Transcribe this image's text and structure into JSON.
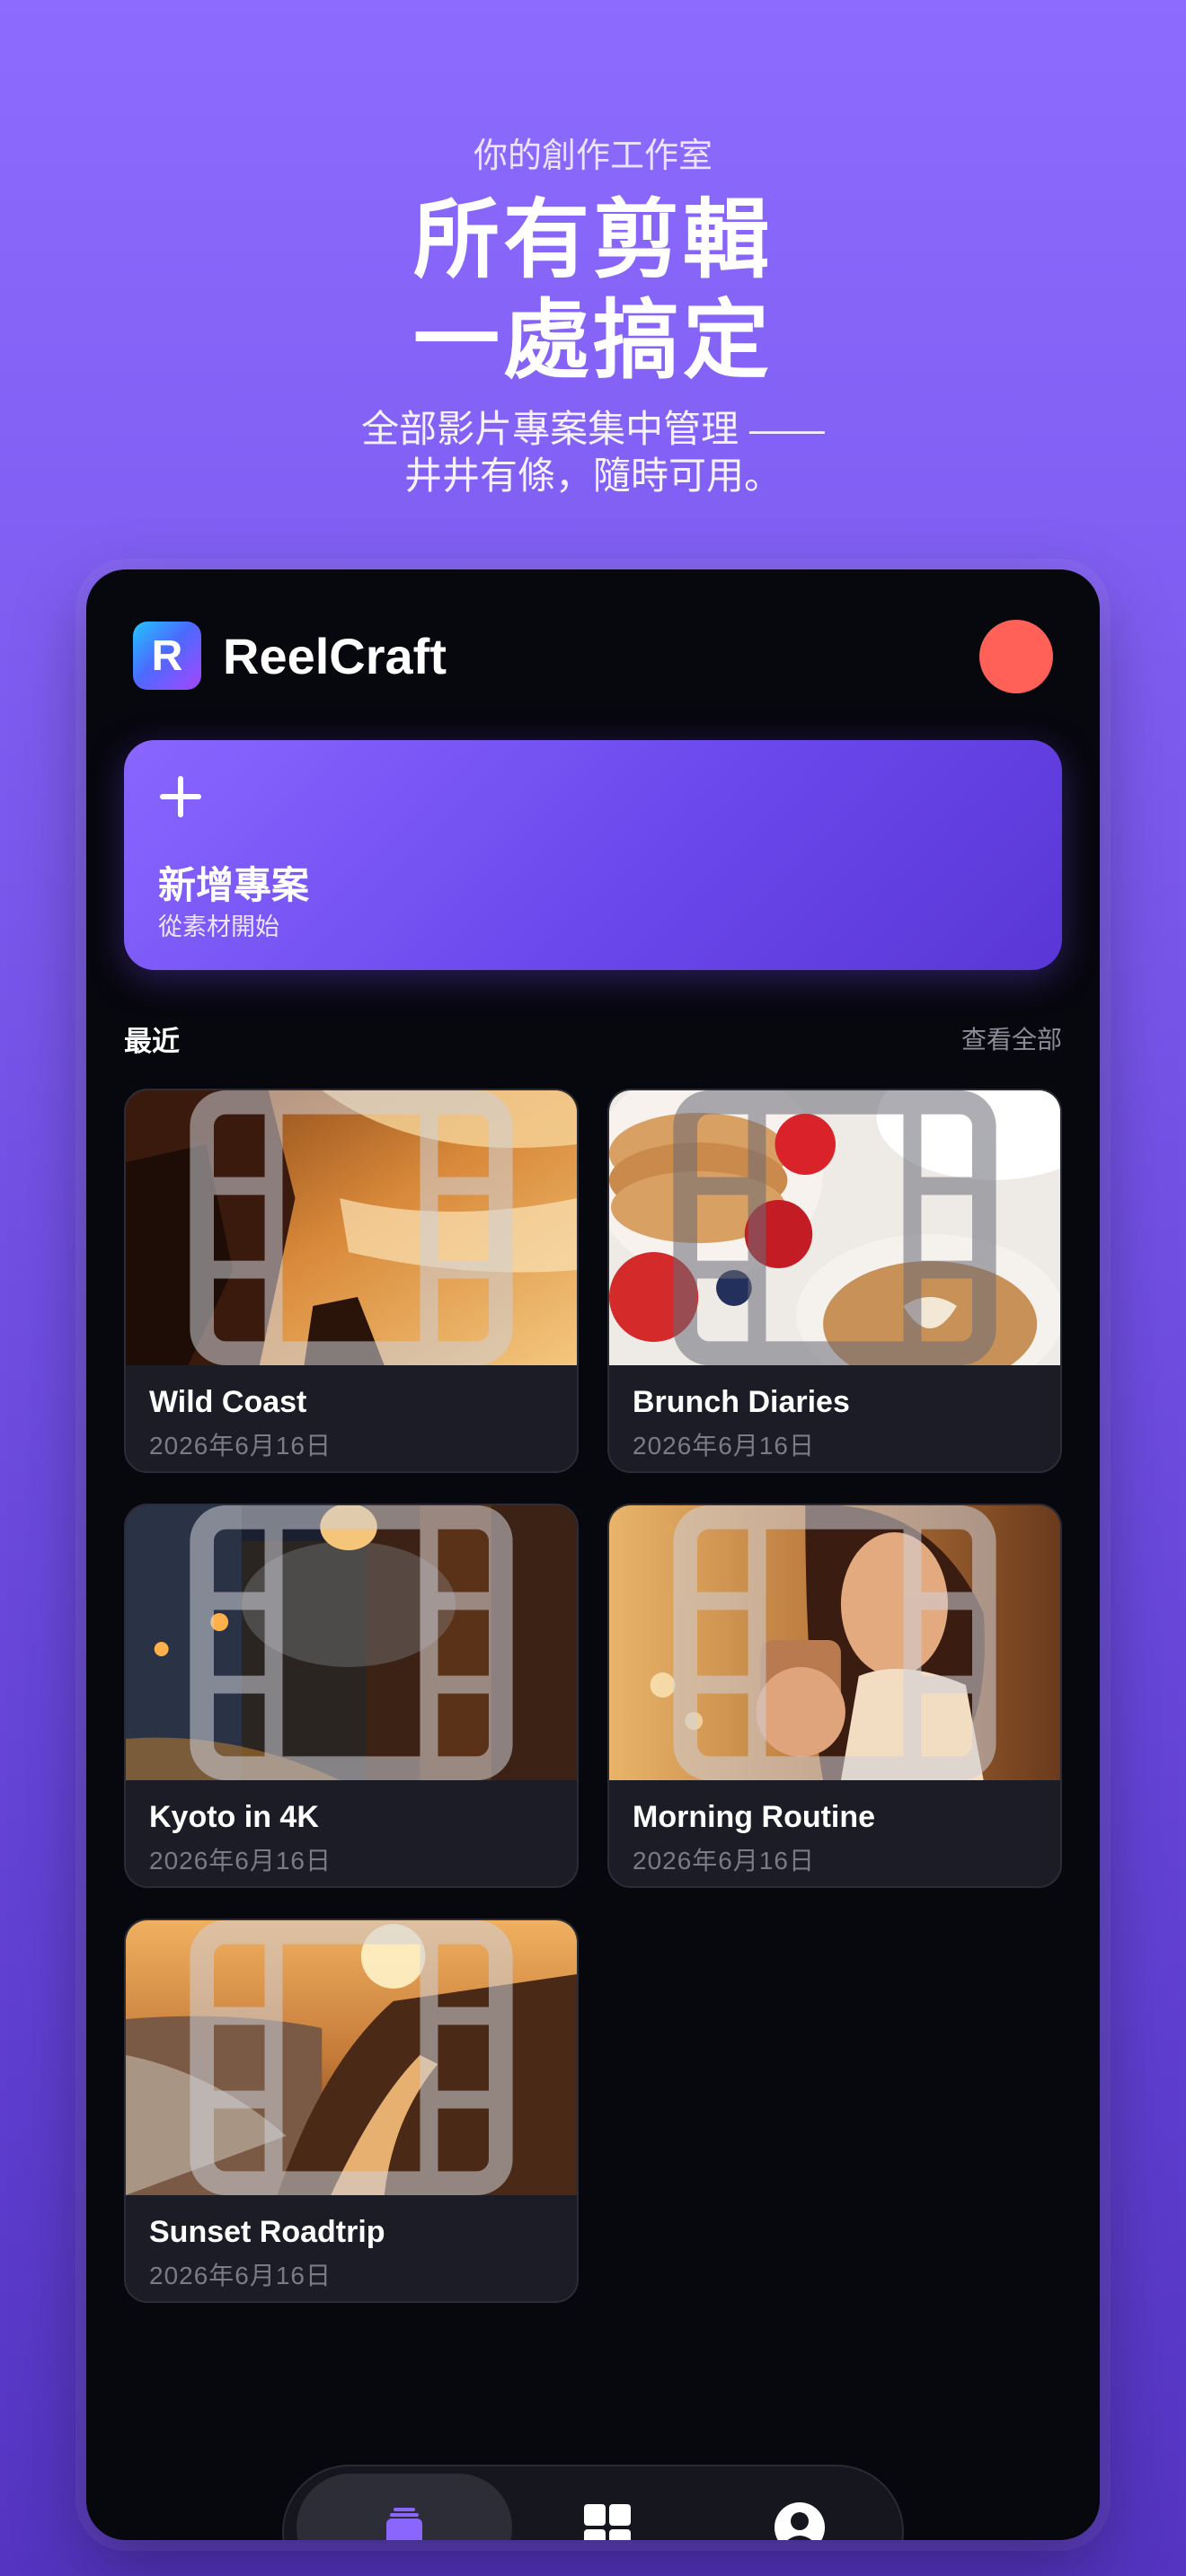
{
  "hero": {
    "eyebrow": "你的創作工作室",
    "headline_line1": "所有剪輯",
    "headline_line2": "一處搞定",
    "subline_line1": "全部影片專案集中管理 ——",
    "subline_line2": "井井有條，隨時可用。"
  },
  "app": {
    "name": "ReelCraft",
    "logo_letter": "R"
  },
  "new_project": {
    "title": "新增專案",
    "subtitle": "從素材開始"
  },
  "recent": {
    "title": "最近",
    "view_all": "查看全部"
  },
  "projects": [
    {
      "title": "Wild Coast",
      "date": "2026年6月16日"
    },
    {
      "title": "Brunch Diaries",
      "date": "2026年6月16日"
    },
    {
      "title": "Kyoto in 4K",
      "date": "2026年6月16日"
    },
    {
      "title": "Morning Routine",
      "date": "2026年6月16日"
    },
    {
      "title": "Sunset Roadtrip",
      "date": "2026年6月16日"
    }
  ],
  "tabs": [
    {
      "icon": "projects-icon",
      "active": true
    },
    {
      "icon": "grid-icon",
      "active": false
    },
    {
      "icon": "profile-icon",
      "active": false
    }
  ],
  "colors": {
    "accent": "#7a57ec",
    "avatar": "#ff6158",
    "background": "#07070e",
    "card": "#1b1c25"
  }
}
